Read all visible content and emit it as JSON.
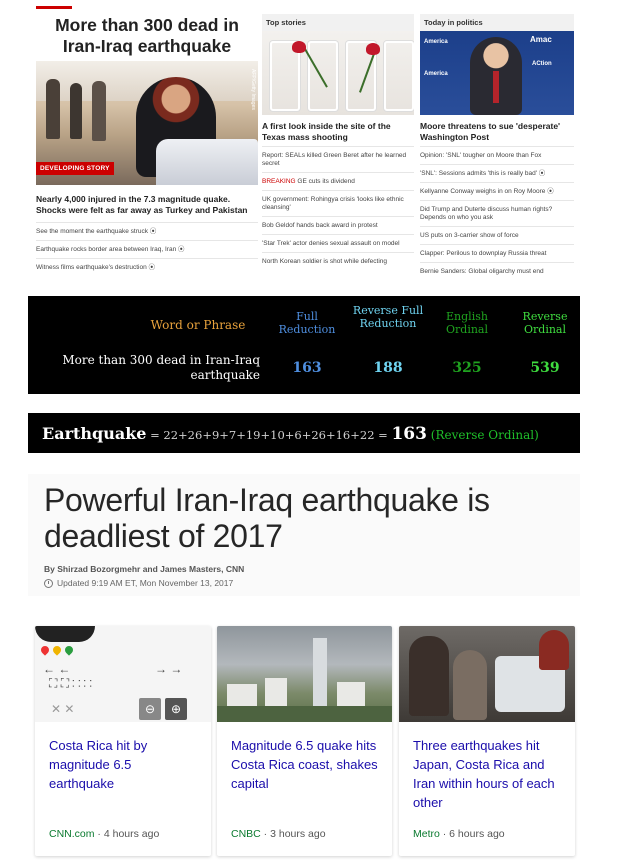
{
  "cnn": {
    "main_headline": "More than 300 dead in Iran-Iraq earthquake",
    "photo_credit": "AFP/Getty Images",
    "developing_tag": "DEVELOPING STORY",
    "sub_headline": "Nearly 4,000 injured in the 7.3 magnitude quake. Shocks were felt as far away as Turkey and Pakistan",
    "main_links": [
      "See the moment the earthquake struck",
      "Earthquake rocks border area between Iraq, Iran",
      "Witness films earthquake's destruction"
    ],
    "top_stories": {
      "header": "Top stories",
      "headline": "A first look inside the site of the Texas mass shooting",
      "links": [
        {
          "prefix": "",
          "text": "Report: SEALs killed Green Beret after he learned secret"
        },
        {
          "prefix": "BREAKING",
          "text": " GE cuts its dividend"
        },
        {
          "prefix": "",
          "text": "UK government: Rohingya crisis 'looks like ethnic cleansing'"
        },
        {
          "prefix": "",
          "text": "Bob Geldof hands back award in protest"
        },
        {
          "prefix": "",
          "text": "'Star Trek' actor denies sexual assault on model"
        },
        {
          "prefix": "",
          "text": "North Korean soldier is shot while defecting"
        }
      ]
    },
    "politics": {
      "header": "Today in politics",
      "logo_1": "America",
      "logo_2": "Amac",
      "logo_3": "ACtion",
      "logo_4": "America",
      "headline": "Moore threatens to sue 'desperate' Washington Post",
      "links": [
        "Opinion: 'SNL' tougher on Moore than Fox",
        "'SNL': Sessions admits 'this is really bad'",
        "Kellyanne Conway weighs in on Roy Moore",
        "Did Trump and Duterte discuss human rights? Depends on who you ask",
        "US puts on 3-carrier show of force",
        "Clapper: Perilous to downplay Russia threat",
        "Bernie Sanders: Global oligarchy must end"
      ]
    }
  },
  "gematria": {
    "header_word": "Word or Phrase",
    "phrase": "More than 300 dead in Iran-Iraq earthquake",
    "columns": [
      {
        "label": "Full Reduction",
        "value": "163",
        "color": "#4f8fe0"
      },
      {
        "label": "Reverse Full Reduction",
        "value": "188",
        "color": "#6fd3f0"
      },
      {
        "label": "English Ordinal",
        "value": "325",
        "color": "#1fa31f"
      },
      {
        "label": "Reverse Ordinal",
        "value": "539",
        "color": "#3fdc3f"
      }
    ]
  },
  "equation": {
    "word": "Earthquake",
    "sum": " = 22+26+9+7+19+10+6+26+16+22 = ",
    "total": "163",
    "cipher": " (Reverse Ordinal)"
  },
  "article": {
    "title": "Powerful Iran-Iraq earthquake is deadliest of 2017",
    "byline": "By Shirzad Bozorgmehr and James Masters, CNN",
    "updated": "Updated 9:19 AM ET, Mon November 13, 2017"
  },
  "cards": [
    {
      "title": "Costa Rica hit by magnitude 6.5 earthquake",
      "source": "CNN.com",
      "age": " · 4 hours ago"
    },
    {
      "title": "Magnitude 6.5 quake hits Costa Rica coast, shakes capital",
      "source": "CNBC",
      "age": " · 3 hours ago"
    },
    {
      "title": "Three earthquakes hit Japan, Costa Rica and Iran within hours of each other",
      "source": "Metro",
      "age": " · 6 hours ago"
    }
  ]
}
